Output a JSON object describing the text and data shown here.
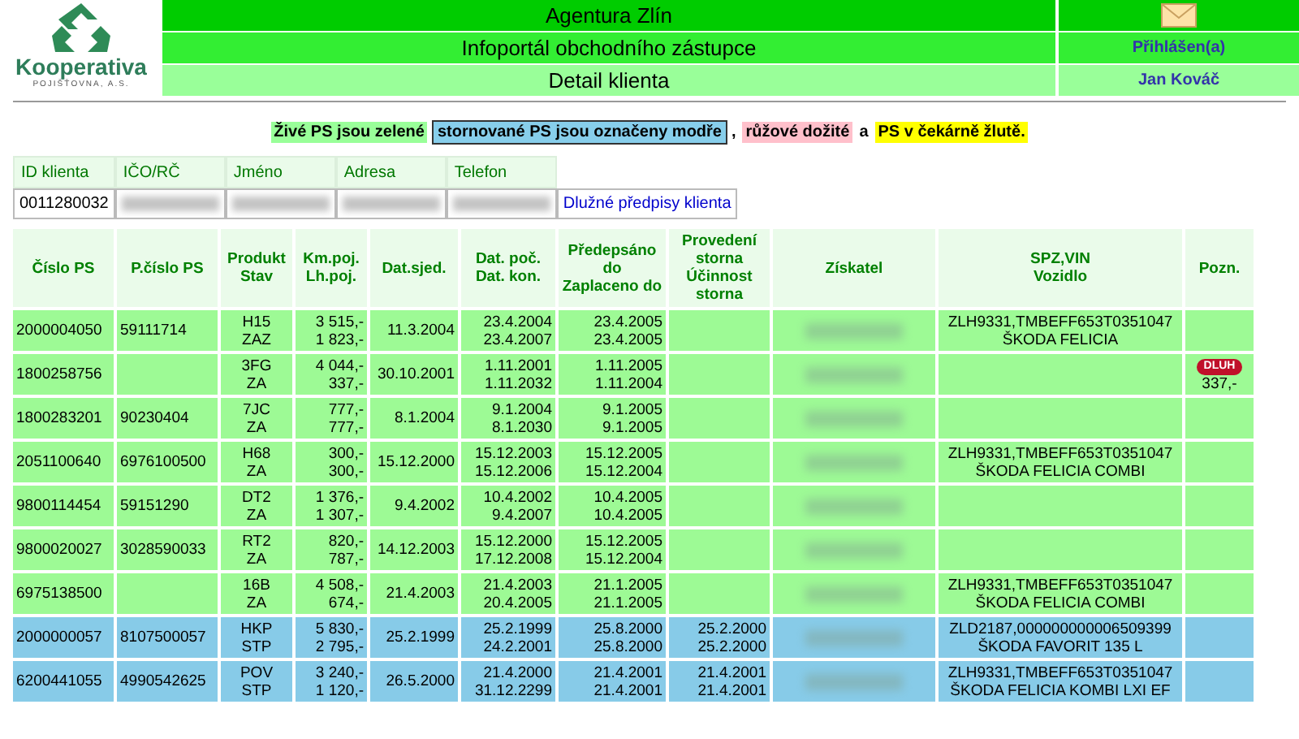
{
  "logo": {
    "name": "Kooperativa",
    "tagline": "POJIŠŤOVNA, A.S."
  },
  "header": {
    "rows": [
      {
        "title": "Agentura Zlín",
        "kind": "mail"
      },
      {
        "title": "Infoportál obchodního zástupce",
        "kind": "text",
        "side": "Přihlášen(a)"
      },
      {
        "title": "Detail klienta",
        "kind": "text",
        "side": "Jan Kováč"
      }
    ]
  },
  "legend": [
    {
      "kind": "tag",
      "text": "Živé PS jsou zelené",
      "color": "#99ff99"
    },
    {
      "kind": "tag",
      "text": "stornované PS jsou označeny modře",
      "color": "#87ceeb"
    },
    {
      "kind": "text",
      "text": ","
    },
    {
      "kind": "tag",
      "text": "růžové dožité",
      "color": "#ffc0cb"
    },
    {
      "kind": "text",
      "text": "a"
    },
    {
      "kind": "tag",
      "text": "PS v čekárně žlutě.",
      "color": "#ffff00"
    }
  ],
  "client": {
    "columns": [
      "ID klienta",
      "IČO/RČ",
      "Jméno",
      "Adresa",
      "Telefon"
    ],
    "id": "0011280032",
    "link": "Dlužné předpisy klienta"
  },
  "table": {
    "columns": [
      [
        "Číslo PS"
      ],
      [
        "P.číslo PS"
      ],
      [
        "Produkt",
        "Stav"
      ],
      [
        "Km.poj.",
        "Lh.poj."
      ],
      [
        "Dat.sjed."
      ],
      [
        "Dat. poč.",
        "Dat. kon."
      ],
      [
        "Předepsáno",
        "do",
        "Zaplaceno do"
      ],
      [
        "Provedení",
        "storna",
        "Účinnost",
        "storna"
      ],
      [
        "Získatel"
      ],
      [
        "SPZ,VIN",
        "Vozidlo"
      ],
      [
        "Pozn."
      ]
    ],
    "rows": [
      {
        "kind": "live",
        "cislo": "2000004050",
        "p_cislo": "59111714",
        "produkt": "H15",
        "stav": "ZAZ",
        "km": "3 515,-",
        "lh": "1 823,-",
        "sjed": "11.3.2004",
        "poc": "23.4.2004",
        "kon": "23.4.2007",
        "predepsano": "23.4.2005",
        "zaplaceno": "23.4.2005",
        "spz": "ZLH9331,TMBEFF653T0351047",
        "vozidlo": "ŠKODA FELICIA"
      },
      {
        "kind": "live",
        "cislo": "1800258756",
        "produkt": "3FG",
        "stav": "ZA",
        "km": "4 044,-",
        "lh": "337,-",
        "sjed": "30.10.2001",
        "poc": "1.11.2001",
        "kon": "1.11.2032",
        "predepsano": "1.11.2005",
        "zaplaceno": "1.11.2004",
        "pozn": {
          "badge": "DLUH",
          "amount": "337,-"
        }
      },
      {
        "kind": "live",
        "cislo": "1800283201",
        "p_cislo": "90230404",
        "produkt": "7JC",
        "stav": "ZA",
        "km": "777,-",
        "lh": "777,-",
        "sjed": "8.1.2004",
        "poc": "9.1.2004",
        "kon": "8.1.2030",
        "predepsano": "9.1.2005",
        "zaplaceno": "9.1.2005"
      },
      {
        "kind": "live",
        "cislo": "2051100640",
        "p_cislo": "6976100500",
        "produkt": "H68",
        "stav": "ZA",
        "km": "300,-",
        "lh": "300,-",
        "sjed": "15.12.2000",
        "poc": "15.12.2003",
        "kon": "15.12.2006",
        "predepsano": "15.12.2005",
        "zaplaceno": "15.12.2004",
        "spz": "ZLH9331,TMBEFF653T0351047",
        "vozidlo": "ŠKODA FELICIA COMBI"
      },
      {
        "kind": "live",
        "cislo": "9800114454",
        "p_cislo": "59151290",
        "produkt": "DT2",
        "stav": "ZA",
        "km": "1 376,-",
        "lh": "1 307,-",
        "sjed": "9.4.2002",
        "poc": "10.4.2002",
        "kon": "9.4.2007",
        "predepsano": "10.4.2005",
        "zaplaceno": "10.4.2005"
      },
      {
        "kind": "live",
        "cislo": "9800020027",
        "p_cislo": "3028590033",
        "produkt": "RT2",
        "stav": "ZA",
        "km": "820,-",
        "lh": "787,-",
        "sjed": "14.12.2003",
        "poc": "15.12.2000",
        "kon": "17.12.2008",
        "predepsano": "15.12.2005",
        "zaplaceno": "15.12.2004"
      },
      {
        "kind": "live",
        "cislo": "6975138500",
        "produkt": "16B",
        "stav": "ZA",
        "km": "4 508,-",
        "lh": "674,-",
        "sjed": "21.4.2003",
        "poc": "21.4.2003",
        "kon": "20.4.2005",
        "predepsano": "21.1.2005",
        "zaplaceno": "21.1.2005",
        "spz": "ZLH9331,TMBEFF653T0351047",
        "vozidlo": "ŠKODA FELICIA COMBI"
      },
      {
        "kind": "storno",
        "cislo": "2000000057",
        "p_cislo": "8107500057",
        "produkt": "HKP",
        "stav": "STP",
        "km": "5 830,-",
        "lh": "2 795,-",
        "sjed": "25.2.1999",
        "poc": "25.2.1999",
        "kon": "24.2.2001",
        "predepsano": "25.8.2000",
        "zaplaceno": "25.8.2000",
        "provedeni": "25.2.2000",
        "ucinnost": "25.2.2000",
        "spz": "ZLD2187,000000000006509399",
        "vozidlo": "ŠKODA FAVORIT 135 L"
      },
      {
        "kind": "storno",
        "cislo": "6200441055",
        "p_cislo": "4990542625",
        "produkt": "POV",
        "stav": "STP",
        "km": "3 240,-",
        "lh": "1 120,-",
        "sjed": "26.5.2000",
        "poc": "21.4.2000",
        "kon": "31.12.2299",
        "predepsano": "21.4.2001",
        "zaplaceno": "21.4.2001",
        "provedeni": "21.4.2001",
        "ucinnost": "21.4.2001",
        "spz": "ZLH9331,TMBEFF653T0351047",
        "vozidlo": "ŠKODA FELICIA KOMBI LXI EF"
      }
    ]
  }
}
